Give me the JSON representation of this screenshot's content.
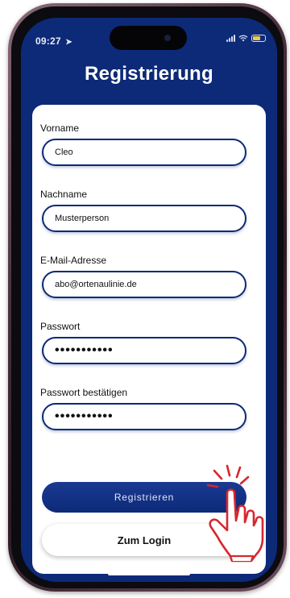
{
  "status_bar": {
    "time": "09:27",
    "location_glyph": "➤"
  },
  "title": "Registrierung",
  "form": {
    "first_name": {
      "label": "Vorname",
      "value": "Cleo"
    },
    "last_name": {
      "label": "Nachname",
      "value": "Musterperson"
    },
    "email": {
      "label": "E-Mail-Adresse",
      "value": "abo@ortenaulinie.de"
    },
    "password": {
      "label": "Passwort",
      "value": "•••••••••••"
    },
    "password_confirm": {
      "label": "Passwort bestätigen",
      "value": "•••••••••••"
    }
  },
  "buttons": {
    "register": "Registrieren",
    "login": "Zum Login"
  },
  "icons": {
    "location": "location-arrow-icon",
    "signal": "cellular-signal-icon",
    "wifi": "wifi-icon",
    "battery": "battery-icon",
    "tap": "tap-hand-icon"
  },
  "colors": {
    "primary": "#0d2a78",
    "tap_hand_outline": "#d8262e",
    "battery_fill": "#f3c740"
  }
}
